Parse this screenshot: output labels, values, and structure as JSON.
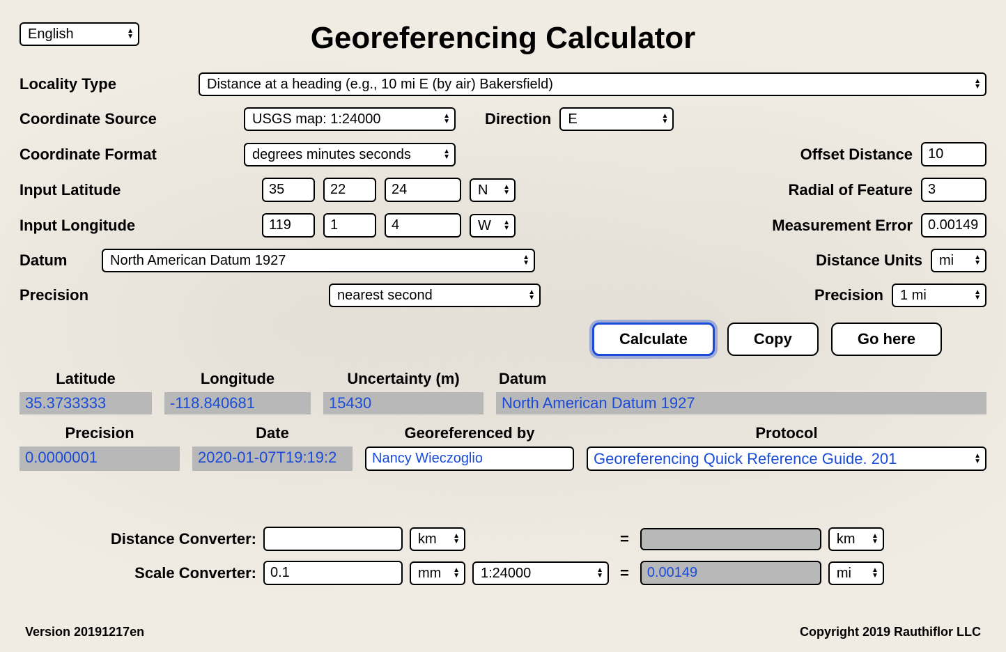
{
  "title": "Georeferencing Calculator",
  "language": "English",
  "labels": {
    "locality_type": "Locality Type",
    "coordinate_source": "Coordinate Source",
    "coordinate_format": "Coordinate Format",
    "input_latitude": "Input Latitude",
    "input_longitude": "Input Longitude",
    "datum": "Datum",
    "precision_left": "Precision",
    "direction": "Direction",
    "offset_distance": "Offset Distance",
    "radial_of_feature": "Radial of Feature",
    "measurement_error": "Measurement Error",
    "distance_units": "Distance Units",
    "precision_right": "Precision"
  },
  "inputs": {
    "locality_type": "Distance at a heading (e.g., 10 mi E (by air) Bakersfield)",
    "coordinate_source": "USGS map: 1:24000",
    "coordinate_format": "degrees minutes seconds",
    "lat_deg": "35",
    "lat_min": "22",
    "lat_sec": "24",
    "lat_dir": "N",
    "lon_deg": "119",
    "lon_min": "1",
    "lon_sec": "4",
    "lon_dir": "W",
    "datum": "North American Datum 1927",
    "precision_left": "nearest second",
    "direction": "E",
    "offset_distance": "10",
    "radial_of_feature": "3",
    "measurement_error": "0.00149",
    "distance_units": "mi",
    "precision_right": "1 mi"
  },
  "buttons": {
    "calculate": "Calculate",
    "copy": "Copy",
    "go_here": "Go here"
  },
  "results": {
    "headers": {
      "latitude": "Latitude",
      "longitude": "Longitude",
      "uncertainty": "Uncertainty (m)",
      "datum": "Datum",
      "precision": "Precision",
      "date": "Date",
      "georef_by": "Georeferenced by",
      "protocol": "Protocol"
    },
    "values": {
      "latitude": "35.3733333",
      "longitude": "-118.840681",
      "uncertainty": "15430",
      "datum": "North American Datum 1927",
      "precision": "0.0000001",
      "date": "2020-01-07T19:19:2",
      "georef_by": "Nancy Wieczoglio",
      "protocol": "Georeferencing Quick Reference Guide. 201"
    }
  },
  "converters": {
    "distance_label": "Distance Converter:",
    "scale_label": "Scale Converter:",
    "distance_in": "",
    "distance_unit_in": "km",
    "distance_out": "",
    "distance_unit_out": "km",
    "scale_in": "0.1",
    "scale_unit_in": "mm",
    "scale_ratio": "1:24000",
    "scale_out": "0.00149",
    "scale_unit_out": "mi",
    "equals": "="
  },
  "footer": {
    "version": "Version 20191217en",
    "copyright": "Copyright 2019 Rauthiflor LLC"
  }
}
